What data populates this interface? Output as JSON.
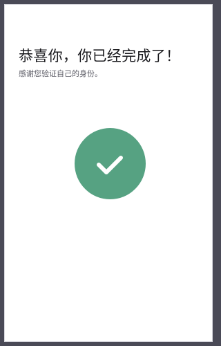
{
  "completion": {
    "title": "恭喜你，你已经完成了！",
    "subtitle": "感谢您验证自己的身份。",
    "icon": "success-checkmark-icon",
    "accent_color": "#56a282"
  }
}
